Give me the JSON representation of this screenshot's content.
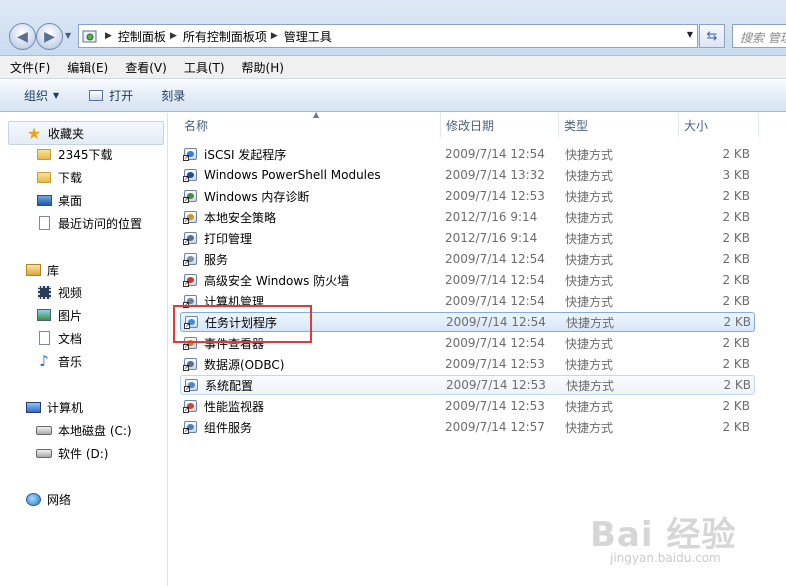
{
  "address_bar": {
    "breadcrumbs": [
      "控制面板",
      "所有控制面板项",
      "管理工具"
    ],
    "search_placeholder": "搜索 管理"
  },
  "menu": [
    "文件(F)",
    "编辑(E)",
    "查看(V)",
    "工具(T)",
    "帮助(H)"
  ],
  "commands": {
    "organize": "组织",
    "open": "打开",
    "burn": "刻录"
  },
  "sidebar": {
    "favorites": {
      "label": "收藏夹",
      "items": [
        "2345下载",
        "下载",
        "桌面",
        "最近访问的位置"
      ]
    },
    "libraries": {
      "label": "库",
      "items": [
        "视频",
        "图片",
        "文档",
        "音乐"
      ]
    },
    "computer": {
      "label": "计算机",
      "items": [
        "本地磁盘 (C:)",
        "软件 (D:)"
      ]
    },
    "network": {
      "label": "网络"
    }
  },
  "columns": {
    "name": "名称",
    "modified": "修改日期",
    "type": "类型",
    "size": "大小"
  },
  "files": [
    {
      "name": "iSCSI 发起程序",
      "modified": "2009/7/14 12:54",
      "type": "快捷方式",
      "size": "2 KB",
      "icon": "iscsi-icon"
    },
    {
      "name": "Windows PowerShell Modules",
      "modified": "2009/7/14 13:32",
      "type": "快捷方式",
      "size": "3 KB",
      "icon": "powershell-icon"
    },
    {
      "name": "Windows 内存诊断",
      "modified": "2009/7/14 12:53",
      "type": "快捷方式",
      "size": "2 KB",
      "icon": "memory-diagnostic-icon"
    },
    {
      "name": "本地安全策略",
      "modified": "2012/7/16 9:14",
      "type": "快捷方式",
      "size": "2 KB",
      "icon": "security-policy-icon"
    },
    {
      "name": "打印管理",
      "modified": "2012/7/16 9:14",
      "type": "快捷方式",
      "size": "2 KB",
      "icon": "print-management-icon"
    },
    {
      "name": "服务",
      "modified": "2009/7/14 12:54",
      "type": "快捷方式",
      "size": "2 KB",
      "icon": "services-icon"
    },
    {
      "name": "高级安全 Windows 防火墙",
      "modified": "2009/7/14 12:54",
      "type": "快捷方式",
      "size": "2 KB",
      "icon": "firewall-icon"
    },
    {
      "name": "计算机管理",
      "modified": "2009/7/14 12:54",
      "type": "快捷方式",
      "size": "2 KB",
      "icon": "computer-management-icon"
    },
    {
      "name": "任务计划程序",
      "modified": "2009/7/14 12:54",
      "type": "快捷方式",
      "size": "2 KB",
      "icon": "task-scheduler-icon"
    },
    {
      "name": "事件查看器",
      "modified": "2009/7/14 12:54",
      "type": "快捷方式",
      "size": "2 KB",
      "icon": "event-viewer-icon"
    },
    {
      "name": "数据源(ODBC)",
      "modified": "2009/7/14 12:53",
      "type": "快捷方式",
      "size": "2 KB",
      "icon": "odbc-icon"
    },
    {
      "name": "系统配置",
      "modified": "2009/7/14 12:53",
      "type": "快捷方式",
      "size": "2 KB",
      "icon": "system-config-icon"
    },
    {
      "name": "性能监视器",
      "modified": "2009/7/14 12:53",
      "type": "快捷方式",
      "size": "2 KB",
      "icon": "performance-monitor-icon"
    },
    {
      "name": "组件服务",
      "modified": "2009/7/14 12:57",
      "type": "快捷方式",
      "size": "2 KB",
      "icon": "component-services-icon"
    }
  ],
  "selected_file": "任务计划程序",
  "watermark": {
    "logo_text": "Bai 经验",
    "url": "jingyan.baidu.com"
  },
  "colors": {
    "highlight_box": "#e03a3a",
    "selection_border": "#84acdd"
  }
}
